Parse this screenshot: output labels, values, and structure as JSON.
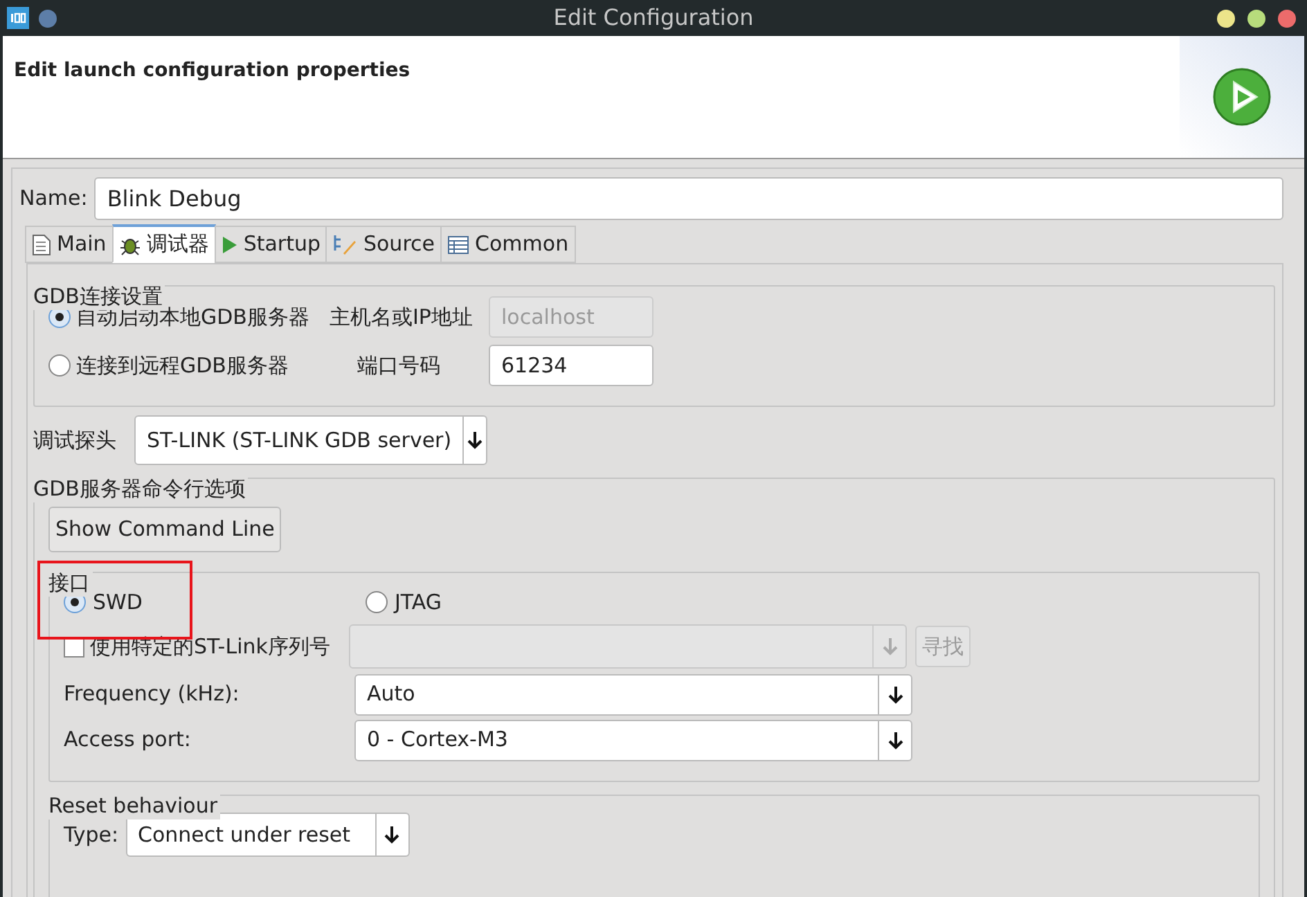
{
  "window": {
    "title": "Edit Configuration"
  },
  "header": {
    "title": "Edit launch configuration properties"
  },
  "name_field": {
    "label": "Name:",
    "value": "Blink Debug"
  },
  "tabs": [
    {
      "label": "Main",
      "kind": "page",
      "selected": false
    },
    {
      "label": "调试器",
      "kind": "bug",
      "selected": true
    },
    {
      "label": "Startup",
      "kind": "play",
      "selected": false
    },
    {
      "label": "Source",
      "kind": "source",
      "selected": false
    },
    {
      "label": "Common",
      "kind": "table",
      "selected": false
    }
  ],
  "gdb_connection": {
    "title": "GDB连接设置",
    "options": [
      {
        "label": "自动启动本地GDB服务器",
        "selected": true,
        "field_label": "主机名或IP地址",
        "field_value": "localhost",
        "field_disabled": true
      },
      {
        "label": "连接到远程GDB服务器",
        "selected": false,
        "field_label": "端口号码",
        "field_value": "61234",
        "field_disabled": false
      }
    ]
  },
  "probe": {
    "label": "调试探头",
    "value": "ST-LINK (ST-LINK GDB server)"
  },
  "server_options": {
    "title": "GDB服务器命令行选项",
    "button": "Show Command Line",
    "interface": {
      "title": "接口",
      "highlighted": true,
      "options": [
        {
          "label": "SWD",
          "selected": true
        },
        {
          "label": "JTAG",
          "selected": false
        }
      ],
      "serial": {
        "label": "使用特定的ST-Link序列号",
        "checked": false,
        "button": "寻找",
        "disabled": true
      },
      "rows": [
        {
          "label": "Frequency (kHz):",
          "value": "Auto"
        },
        {
          "label": "Access port:",
          "value": "0 - Cortex-M3"
        }
      ]
    },
    "reset": {
      "title": "Reset behaviour",
      "type_label": "Type:",
      "type_value": "Connect under reset"
    }
  }
}
